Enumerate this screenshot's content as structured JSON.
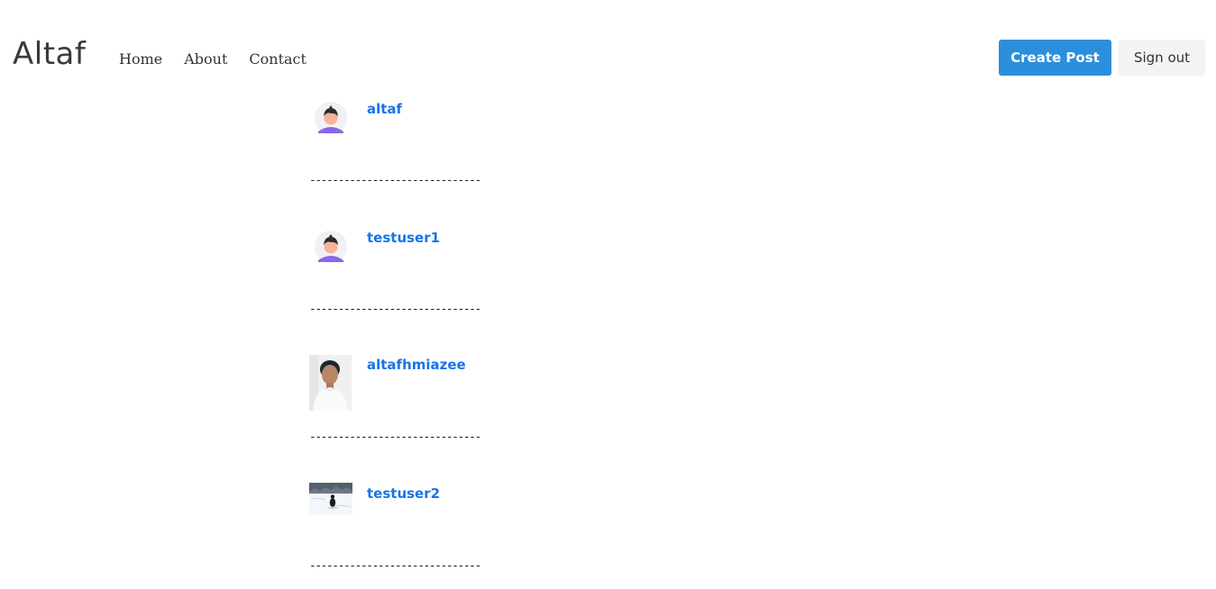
{
  "header": {
    "brand": "Altaf",
    "nav": [
      {
        "label": "Home"
      },
      {
        "label": "About"
      },
      {
        "label": "Contact"
      }
    ],
    "create_post_label": "Create Post",
    "sign_out_label": "Sign out"
  },
  "users": [
    {
      "username": "altaf",
      "avatar": "default-avatar-icon"
    },
    {
      "username": "testuser1",
      "avatar": "default-avatar-icon"
    },
    {
      "username": "altafhmiazee",
      "avatar": "profile-photo"
    },
    {
      "username": "testuser2",
      "avatar": "snow-photo"
    }
  ],
  "divider": "------------------------------",
  "colors": {
    "primary_button": "#2b8fdc",
    "username_link": "#1a73e8",
    "secondary_button": "#f3f3f3"
  }
}
